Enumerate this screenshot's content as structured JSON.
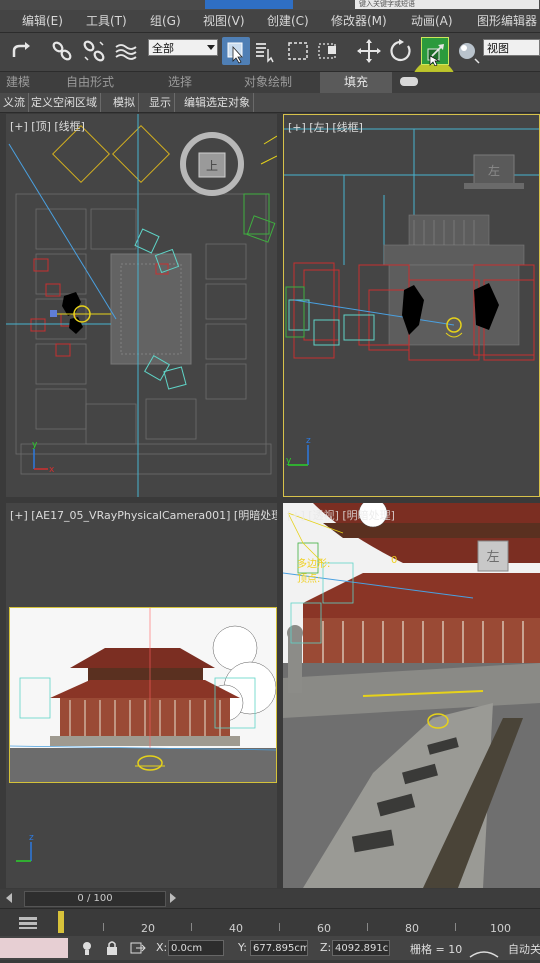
{
  "titlebar": {
    "search_placeholder": "键入关键字或短语"
  },
  "menu": [
    "编辑(E)",
    "工具(T)",
    "组(G)",
    "视图(V)",
    "创建(C)",
    "修改器(M)",
    "动画(A)",
    "图形编辑器"
  ],
  "toolbar": {
    "selection_filter": "全部",
    "reference_coord": "视图",
    "icons": [
      "redo-icon",
      "link-icon",
      "unlink-icon",
      "bind-spacewarp-icon",
      "select-object-icon",
      "select-by-name-icon",
      "rect-selection-icon",
      "window-crossing-icon",
      "move-icon",
      "rotate-icon",
      "scale-icon",
      "placement-icon"
    ]
  },
  "ribbon": {
    "tabs": [
      "建模",
      "自由形式",
      "选择",
      "对象绘制",
      "填充"
    ],
    "active": "填充"
  },
  "subribbon": [
    "义流",
    "定义空闲区域",
    "模拟",
    "显示",
    "编辑选定对象"
  ],
  "viewports": {
    "top": {
      "label": "[+] [顶] [线框]",
      "viewcube": "上"
    },
    "left": {
      "label": "[+] [左] [线框]",
      "viewcube": "左"
    },
    "camera": {
      "label": "[+] [AE17_05_VRayPhysicalCamera001] [明暗处理"
    },
    "perspective": {
      "label": "[+] [透视] [明暗处理]",
      "overlay_1": "多边形:",
      "overlay_2": "顶点:",
      "overlay_val": "0",
      "sign": "左"
    }
  },
  "timeline": {
    "frame": "0 / 100",
    "ticks": [
      "20",
      "40",
      "60",
      "80",
      "100"
    ]
  },
  "status": {
    "x_label": "X:",
    "x": "0.0cm",
    "y_label": "Y:",
    "y": "677.895cm",
    "z_label": "Z:",
    "z": "4092.891c",
    "grid": "栅格 = 10",
    "autokey": "自动关"
  }
}
